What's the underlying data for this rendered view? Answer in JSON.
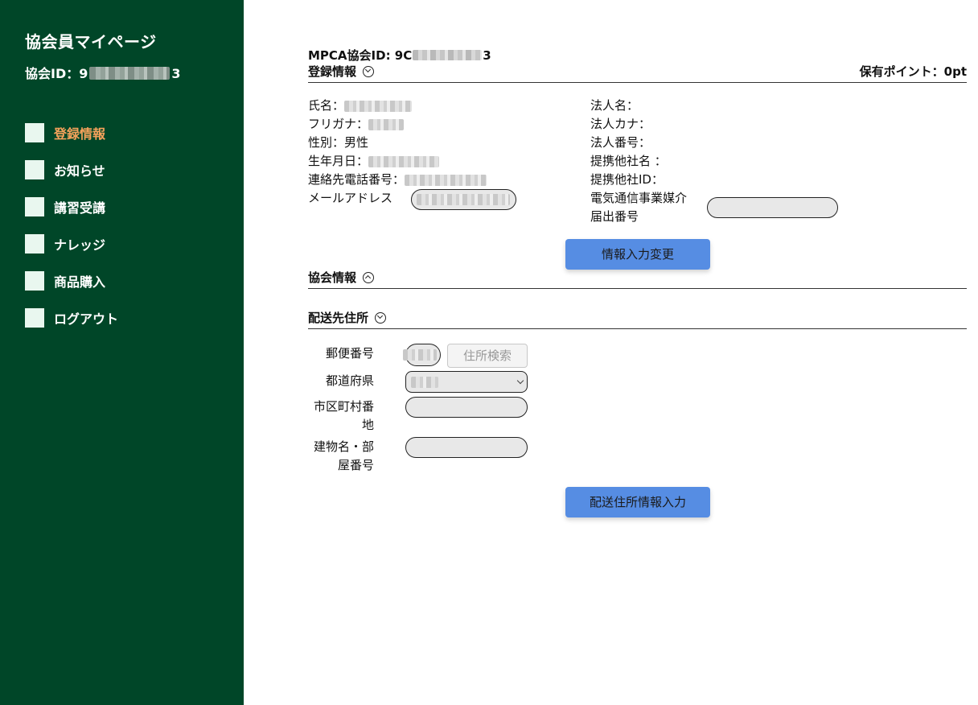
{
  "sidebar": {
    "title": "協会員マイページ",
    "id_prefix": "協会ID：9",
    "id_suffix": "3",
    "items": [
      {
        "label": "登録情報",
        "active": true
      },
      {
        "label": "お知らせ"
      },
      {
        "label": "講習受講"
      },
      {
        "label": "ナレッジ"
      },
      {
        "label": "商品購入"
      },
      {
        "label": "ログアウト"
      }
    ]
  },
  "main": {
    "mpca_prefix": "MPCA協会ID: 9C",
    "mpca_suffix": "3",
    "registration": {
      "heading": "登録情報",
      "points": "保有ポイント：0pt",
      "left_fields": {
        "name": "氏名：",
        "kana": "フリガナ：",
        "gender": "性別：男性",
        "birth": "生年月日：",
        "phone": "連絡先電話番号：",
        "email": "メールアドレス"
      },
      "right_fields": {
        "corp_name": "法人名：",
        "corp_kana": "法人カナ：",
        "corp_no": "法人番号：",
        "partner_name": "提携他社名 ：",
        "partner_id": "提携他社ID：",
        "telecom_line1": "電気通信事業媒介",
        "telecom_line2": "届出番号"
      },
      "edit_button": "情報入力変更"
    },
    "association": {
      "heading": "協会情報"
    },
    "delivery": {
      "heading": "配送先住所",
      "postal_label": "郵便番号",
      "search_button": "住所検索",
      "pref_label": "都道府県",
      "city_label_1": "市区町村番",
      "city_label_2": "地",
      "building_label_1": "建物名・部",
      "building_label_2": "屋番号",
      "submit_button": "配送住所情報入力"
    }
  },
  "colors": {
    "sidebar_bg": "#004628",
    "active_nav": "#f4a25b",
    "button_blue": "#568de3"
  },
  "icons": [
    "chevron-circle-down-icon",
    "chevron-circle-up-icon",
    "select-chevron-icon"
  ]
}
